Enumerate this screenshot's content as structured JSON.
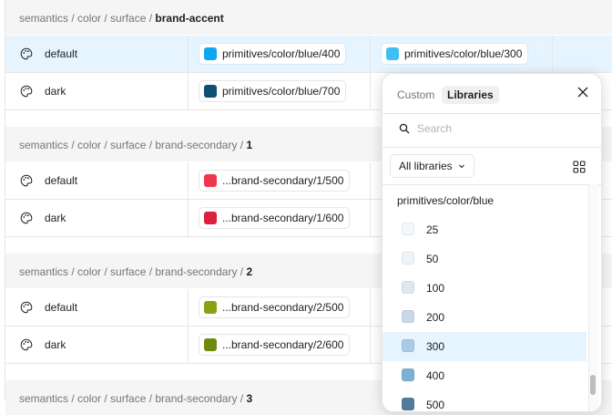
{
  "groups": [
    {
      "path": "semantics / color / surface / ",
      "name": "brand-accent",
      "rows": [
        {
          "label": "default",
          "values": [
            {
              "swatch": "#0fa5ef",
              "text": "primitives/color/blue/400"
            },
            {
              "swatch": "#3fc0f3",
              "text": "primitives/color/blue/300"
            }
          ]
        },
        {
          "label": "dark",
          "values": [
            {
              "swatch": "#0e4f74",
              "text": "primitives/color/blue/700"
            }
          ]
        }
      ]
    },
    {
      "path": "semantics / color / surface / brand-secondary / ",
      "name": "1",
      "rows": [
        {
          "label": "default",
          "values": [
            {
              "swatch": "#f0364d",
              "text": "...brand-secondary/1/500"
            }
          ]
        },
        {
          "label": "dark",
          "values": [
            {
              "swatch": "#dc1f3c",
              "text": "...brand-secondary/1/600"
            }
          ]
        }
      ]
    },
    {
      "path": "semantics / color / surface / brand-secondary / ",
      "name": "2",
      "rows": [
        {
          "label": "default",
          "values": [
            {
              "swatch": "#89a213",
              "text": "...brand-secondary/2/500"
            }
          ]
        },
        {
          "label": "dark",
          "values": [
            {
              "swatch": "#6f8a0c",
              "text": "...brand-secondary/2/600"
            }
          ]
        }
      ]
    },
    {
      "path": "semantics / color / surface / brand-secondary / ",
      "name": "3",
      "rows": []
    }
  ],
  "picker": {
    "tabs": [
      "Custom",
      "Libraries"
    ],
    "search_placeholder": "Search",
    "library_filter": "All libraries",
    "section": "primitives/color/blue",
    "items": [
      {
        "value": "25",
        "swatch": "#f4f7fa"
      },
      {
        "value": "50",
        "swatch": "#eef3f8"
      },
      {
        "value": "100",
        "swatch": "#dde8f2"
      },
      {
        "value": "200",
        "swatch": "#c9d7e7"
      },
      {
        "value": "300",
        "swatch": "#a9cbe7",
        "selected": true
      },
      {
        "value": "400",
        "swatch": "#7eb0d6"
      },
      {
        "value": "500",
        "swatch": "#507c9b"
      }
    ]
  }
}
